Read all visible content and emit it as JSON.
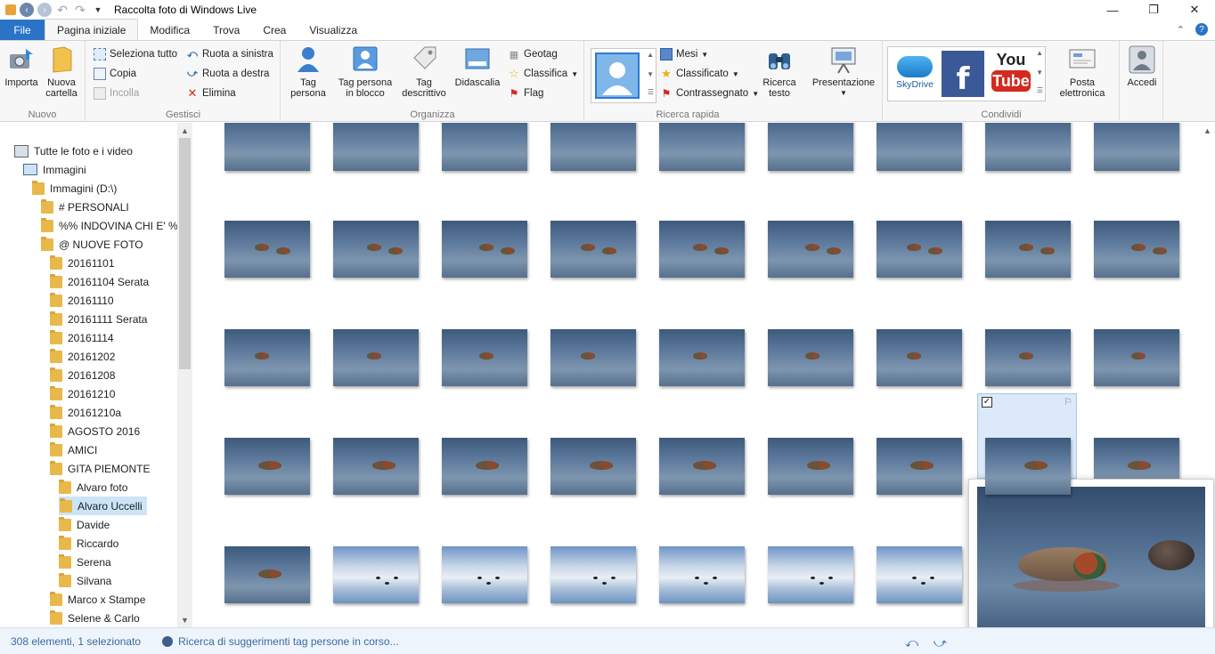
{
  "window": {
    "title": "Raccolta foto di Windows Live"
  },
  "controls": {
    "minimize": "—",
    "maximize": "❐",
    "close": "✕"
  },
  "tabs": [
    "File",
    "Pagina iniziale",
    "Modifica",
    "Trova",
    "Crea",
    "Visualizza"
  ],
  "ribbon": {
    "nuovo": {
      "label": "Nuovo",
      "importa": "Importa",
      "nuova_cartella": "Nuova\ncartella"
    },
    "gestisci": {
      "label": "Gestisci",
      "seleziona_tutto": "Seleziona tutto",
      "copia": "Copia",
      "incolla": "Incolla",
      "ruota_sinistra": "Ruota a sinistra",
      "ruota_destra": "Ruota a destra",
      "elimina": "Elimina"
    },
    "organizza": {
      "label": "Organizza",
      "tag_persona": "Tag\npersona",
      "tag_blocco": "Tag persona\nin blocco",
      "tag_descrittivo": "Tag\ndescrittivo",
      "didascalia": "Didascalia",
      "geotag": "Geotag",
      "classifica": "Classifica",
      "flag": "Flag"
    },
    "ricerca": {
      "label": "Ricerca rapida",
      "mesi": "Mesi",
      "classificato": "Classificato",
      "contrassegnato": "Contrassegnato",
      "ricerca_testo": "Ricerca\ntesto"
    },
    "presentazione": "Presentazione",
    "condividi": {
      "label": "Condividi",
      "skydrive": "SkyDrive",
      "youtube_top": "You",
      "youtube_bottom": "Tube",
      "posta": "Posta\nelettronica"
    },
    "accedi": "Accedi"
  },
  "tree": [
    {
      "label": "Tutte le foto e i video",
      "type": "all"
    },
    {
      "label": "Immagini",
      "type": "lib"
    },
    {
      "label": "Immagini (D:\\)",
      "type": "folder"
    },
    {
      "label": "#   PERSONALI",
      "type": "folder"
    },
    {
      "label": "%%  INDOVINA CHI E' %",
      "type": "folder"
    },
    {
      "label": "@  NUOVE FOTO",
      "type": "folder"
    },
    {
      "label": "20161101",
      "type": "folder"
    },
    {
      "label": "20161104 Serata",
      "type": "folder"
    },
    {
      "label": "20161110",
      "type": "folder"
    },
    {
      "label": "20161111 Serata",
      "type": "folder"
    },
    {
      "label": "20161114",
      "type": "folder"
    },
    {
      "label": "20161202",
      "type": "folder"
    },
    {
      "label": "20161208",
      "type": "folder"
    },
    {
      "label": "20161210",
      "type": "folder"
    },
    {
      "label": "20161210a",
      "type": "folder"
    },
    {
      "label": "AGOSTO 2016",
      "type": "folder"
    },
    {
      "label": "AMICI",
      "type": "folder"
    },
    {
      "label": "GITA PIEMONTE",
      "type": "folder"
    },
    {
      "label": "Alvaro foto",
      "type": "folder"
    },
    {
      "label": "Alvaro Uccelli",
      "type": "folder",
      "selected": true
    },
    {
      "label": "Davide",
      "type": "folder"
    },
    {
      "label": "Riccardo",
      "type": "folder"
    },
    {
      "label": "Serena",
      "type": "folder"
    },
    {
      "label": "Silvana",
      "type": "folder"
    },
    {
      "label": "Marco x Stampe",
      "type": "folder"
    },
    {
      "label": "Selene & Carlo",
      "type": "folder"
    }
  ],
  "status": {
    "count": "308 elementi, 1 selezionato",
    "task": "Ricerca di suggerimenti tag persone in corso..."
  },
  "colors": {
    "accent": "#2a73c6",
    "selection": "#cce4f7",
    "status_text": "#3a6aa5"
  }
}
